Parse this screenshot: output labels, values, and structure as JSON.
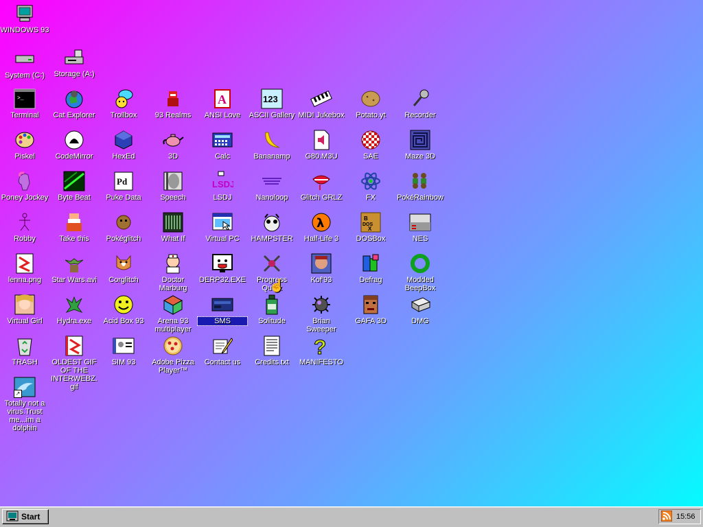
{
  "desktop": {
    "icons": {
      "windows93": "WINDOWS 93",
      "system_c": "System (C:)",
      "storage_a": "Storage (A:)",
      "terminal": "Terminal",
      "cat_explorer": "Cat Explorer",
      "trollbox": "Trollbox",
      "realms93": "93 Realms",
      "ansi_love": "ANSI Love",
      "ascii_gallery": "ASCII Gallery",
      "midi_jukebox": "MIDI Jukebox",
      "potato_yt": "Potato.yt",
      "recorder": "Recorder",
      "piskel": "Piskel",
      "codemirror": "CodeMirror",
      "hexed": "HexEd",
      "three_d": "3D",
      "calc": "Calc",
      "bananamp": "Bananamp",
      "g80_m3u": "G80.M3U",
      "sae": "SAE",
      "maze_3d": "Maze 3D",
      "poney_jockey": "Poney Jockey",
      "byte_beat": "Byte Beat",
      "puke_data": "Puke Data",
      "speech": "Speech",
      "lsdj": "LSDJ",
      "nanoloop": "Nanoloop",
      "glitch_grlz": "Glitch GRLZ",
      "fx": "FX",
      "pokerainbow": "PokéRainbow",
      "robby": "Robby",
      "take_this": "Take this",
      "pokeglitch": "Pokéglitch",
      "what_if": "What If",
      "virtual_pc": "Virtual PC",
      "hampster": "HAMPSTER",
      "half_life_3": "Half-Life 3",
      "dosbox": "DOSBox",
      "nes": "NES",
      "lenna_png": "lenna.png",
      "star_wars": "Star Wars.avi",
      "corglitch": "Corglitch",
      "doctor_marburg": "Doctor Marburg",
      "derp32": "DERP32.EXE",
      "progress_quest": "Progress Quest",
      "kof93": "Kof'93",
      "defrag": "Defrag",
      "modded_beepbox": "Modded BeepBox",
      "virtual_girl": "Virtual Girl",
      "hydra_exe": "Hydra.exe",
      "acid_box": "Acid Box 93",
      "arena93": "Arena 93 multiplayer",
      "sms": "SMS",
      "solitude": "Solitude",
      "brian_sweeper": "Brian Sweeper",
      "gafa_3d": "GAFA 3D",
      "dmg": "DMG",
      "trash": "TRASH",
      "oldest_gif": "OLDEST GIF OF THE INTERWEBZ.gif",
      "sim93": "SIM 93",
      "adobe_pizza": "Adobe Pizza Player™",
      "contact_us": "Contact us",
      "credits_txt": "Credits.txt",
      "manifesto": "MANIFESTO",
      "dolphin": "Totally not a virus.Trust me...im a dolphin"
    }
  },
  "taskbar": {
    "start_label": "Start",
    "clock": "15:56"
  },
  "colors": {
    "gradient_start": "#ff00ff",
    "gradient_end": "#00ffff",
    "taskbar": "#c0c0c0",
    "selection": "#1a1ab0"
  }
}
